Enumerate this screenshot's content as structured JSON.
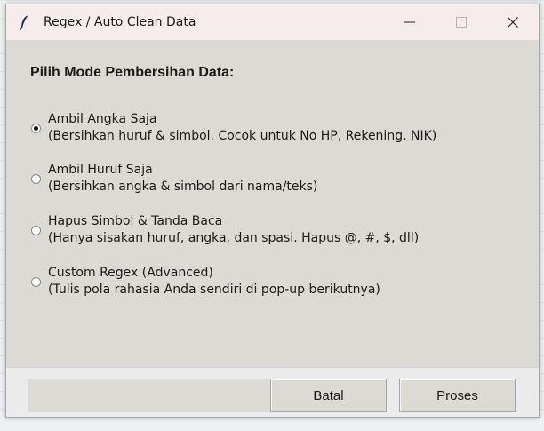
{
  "window": {
    "title": "Regex / Auto Clean Data",
    "icons": {
      "app": "feather-icon",
      "minimize": "minimize-icon",
      "maximize": "maximize-icon",
      "close": "close-icon"
    }
  },
  "heading": "Pilih Mode Pembersihan Data:",
  "options": [
    {
      "label": "Ambil Angka Saja",
      "description": "(Bersihkan huruf & simbol. Cocok untuk No HP, Rekening, NIK)",
      "checked": true
    },
    {
      "label": "Ambil Huruf Saja",
      "description": "(Bersihkan angka & simbol dari nama/teks)",
      "checked": false
    },
    {
      "label": "Hapus Simbol & Tanda Baca",
      "description": "(Hanya sisakan huruf, angka, dan spasi. Hapus @, #, $, dll)",
      "checked": false
    },
    {
      "label": "Custom Regex (Advanced)",
      "description": "(Tulis pola rahasia Anda sendiri di pop-up berikutnya)",
      "checked": false
    }
  ],
  "buttons": {
    "cancel": "Batal",
    "submit": "Proses"
  },
  "colors": {
    "window_bg": "#dcdad5",
    "titlebar_bg": "#f7ecec",
    "footer_bg": "#ebebeb"
  }
}
